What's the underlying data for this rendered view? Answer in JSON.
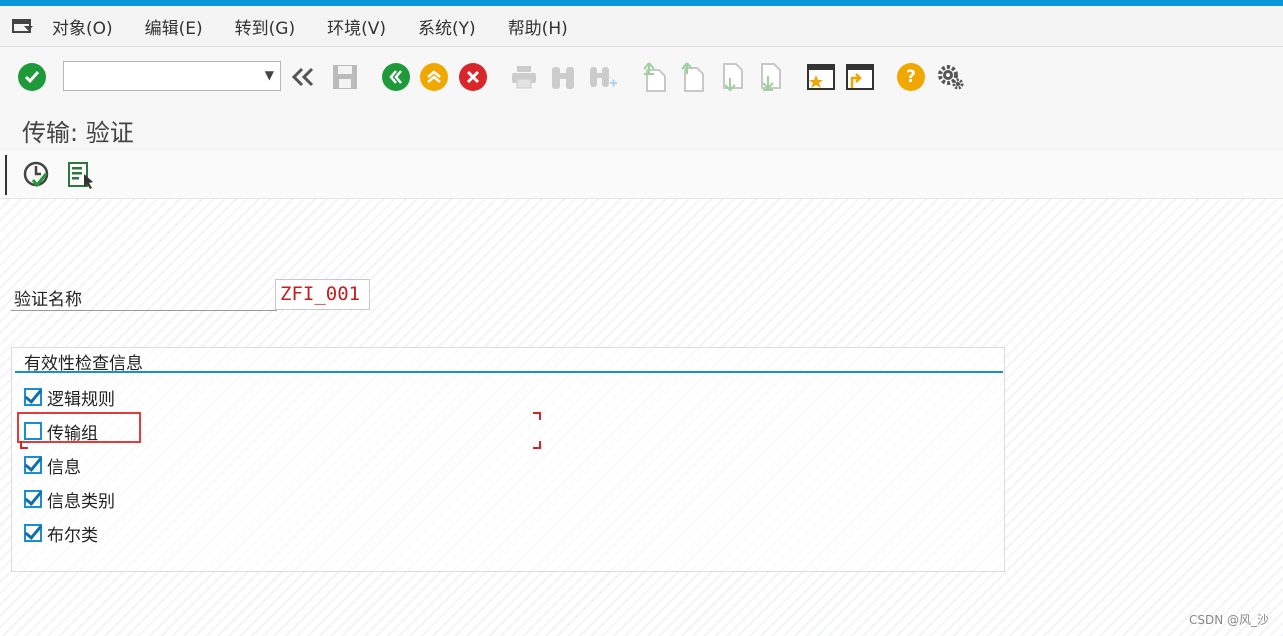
{
  "menubar": {
    "items": [
      {
        "label": "对象(O)"
      },
      {
        "label": "编辑(E)"
      },
      {
        "label": "转到(G)"
      },
      {
        "label": "环境(V)"
      },
      {
        "label": "系统(Y)"
      },
      {
        "label": "帮助(H)"
      }
    ]
  },
  "toolbar": {
    "command_value": "",
    "icons": [
      "enter-icon",
      "command-dropdown-icon",
      "collapse-icon",
      "save-icon",
      "back-icon",
      "exit-icon",
      "cancel-icon",
      "print-icon",
      "find-icon",
      "find-next-icon",
      "first-page-icon",
      "previous-page-icon",
      "next-page-icon",
      "last-page-icon",
      "create-session-icon",
      "generate-shortcut-icon",
      "help-icon",
      "settings-icon"
    ],
    "colors": {
      "enter": "#1f9a3a",
      "back": "#1f9a3a",
      "exit": "#f0a800",
      "cancel": "#d9262b",
      "help": "#f0a800",
      "accent": "#0a96d8"
    }
  },
  "page": {
    "title": "传输: 验证"
  },
  "app_toolbar": {
    "icons": [
      "execute-icon",
      "document-icon"
    ]
  },
  "form": {
    "name_label": "验证名称",
    "name_value": "ZFI_001",
    "group_title": "有效性检查信息",
    "options": [
      {
        "label": "逻辑规则",
        "checked": true
      },
      {
        "label": "传输组",
        "checked": false
      },
      {
        "label": "信息",
        "checked": true
      },
      {
        "label": "信息类别",
        "checked": true
      },
      {
        "label": "布尔类",
        "checked": true
      }
    ]
  },
  "watermark": "CSDN @风_沙"
}
